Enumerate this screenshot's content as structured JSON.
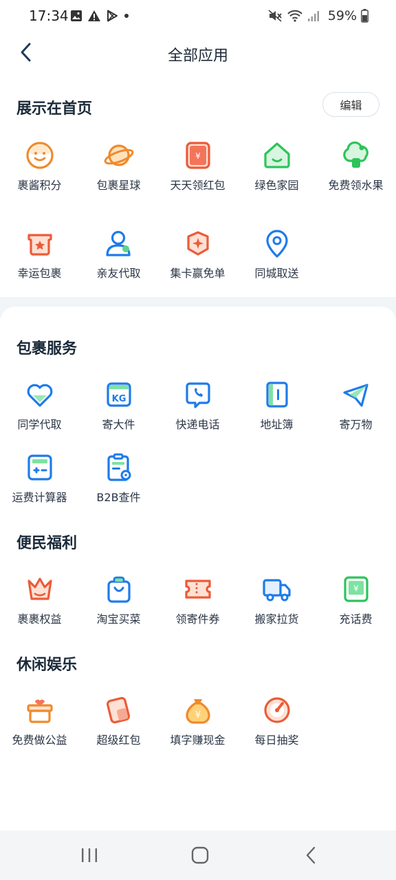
{
  "status_bar": {
    "time": "17:34",
    "battery": "59%"
  },
  "header": {
    "title": "全部应用"
  },
  "sections": {
    "home": {
      "title": "展示在首页",
      "edit_label": "编辑"
    },
    "parcel": {
      "title": "包裹服务"
    },
    "welfare": {
      "title": "便民福利"
    },
    "leisure": {
      "title": "休闲娱乐"
    }
  },
  "home_apps": [
    {
      "label": "裹酱积分",
      "icon": "smile-coin-icon"
    },
    {
      "label": "包裹星球",
      "icon": "planet-icon"
    },
    {
      "label": "天天领红包",
      "icon": "red-envelope-icon"
    },
    {
      "label": "绿色家园",
      "icon": "green-home-icon"
    },
    {
      "label": "免费领水果",
      "icon": "tree-fruit-icon"
    },
    {
      "label": "幸运包裹",
      "icon": "lucky-box-icon"
    },
    {
      "label": "亲友代取",
      "icon": "friend-user-icon"
    },
    {
      "label": "集卡赢免单",
      "icon": "card-collect-icon"
    },
    {
      "label": "同城取送",
      "icon": "location-pin-icon"
    }
  ],
  "parcel_apps": [
    {
      "label": "同学代取",
      "icon": "heart-icon"
    },
    {
      "label": "寄大件",
      "icon": "kg-box-icon"
    },
    {
      "label": "快递电话",
      "icon": "phone-icon"
    },
    {
      "label": "地址簿",
      "icon": "address-book-icon"
    },
    {
      "label": "寄万物",
      "icon": "paper-plane-icon"
    },
    {
      "label": "运费计算器",
      "icon": "calculator-icon"
    },
    {
      "label": "B2B查件",
      "icon": "clipboard-search-icon"
    }
  ],
  "welfare_apps": [
    {
      "label": "裹裹权益",
      "icon": "crown-icon"
    },
    {
      "label": "淘宝买菜",
      "icon": "shopping-bag-icon"
    },
    {
      "label": "领寄件券",
      "icon": "ticket-icon"
    },
    {
      "label": "搬家拉货",
      "icon": "truck-icon"
    },
    {
      "label": "充话费",
      "icon": "phone-bill-icon"
    }
  ],
  "leisure_apps": [
    {
      "label": "免费做公益",
      "icon": "charity-box-icon"
    },
    {
      "label": "超级红包",
      "icon": "super-envelope-icon"
    },
    {
      "label": "填字赚现金",
      "icon": "money-bag-icon"
    },
    {
      "label": "每日抽奖",
      "icon": "lottery-dial-icon"
    }
  ],
  "colors": {
    "orange": "#F08A2B",
    "red": "#EC5B39",
    "green": "#2CC45A",
    "blue": "#1E7BEA",
    "title": "#1B2A3A"
  }
}
